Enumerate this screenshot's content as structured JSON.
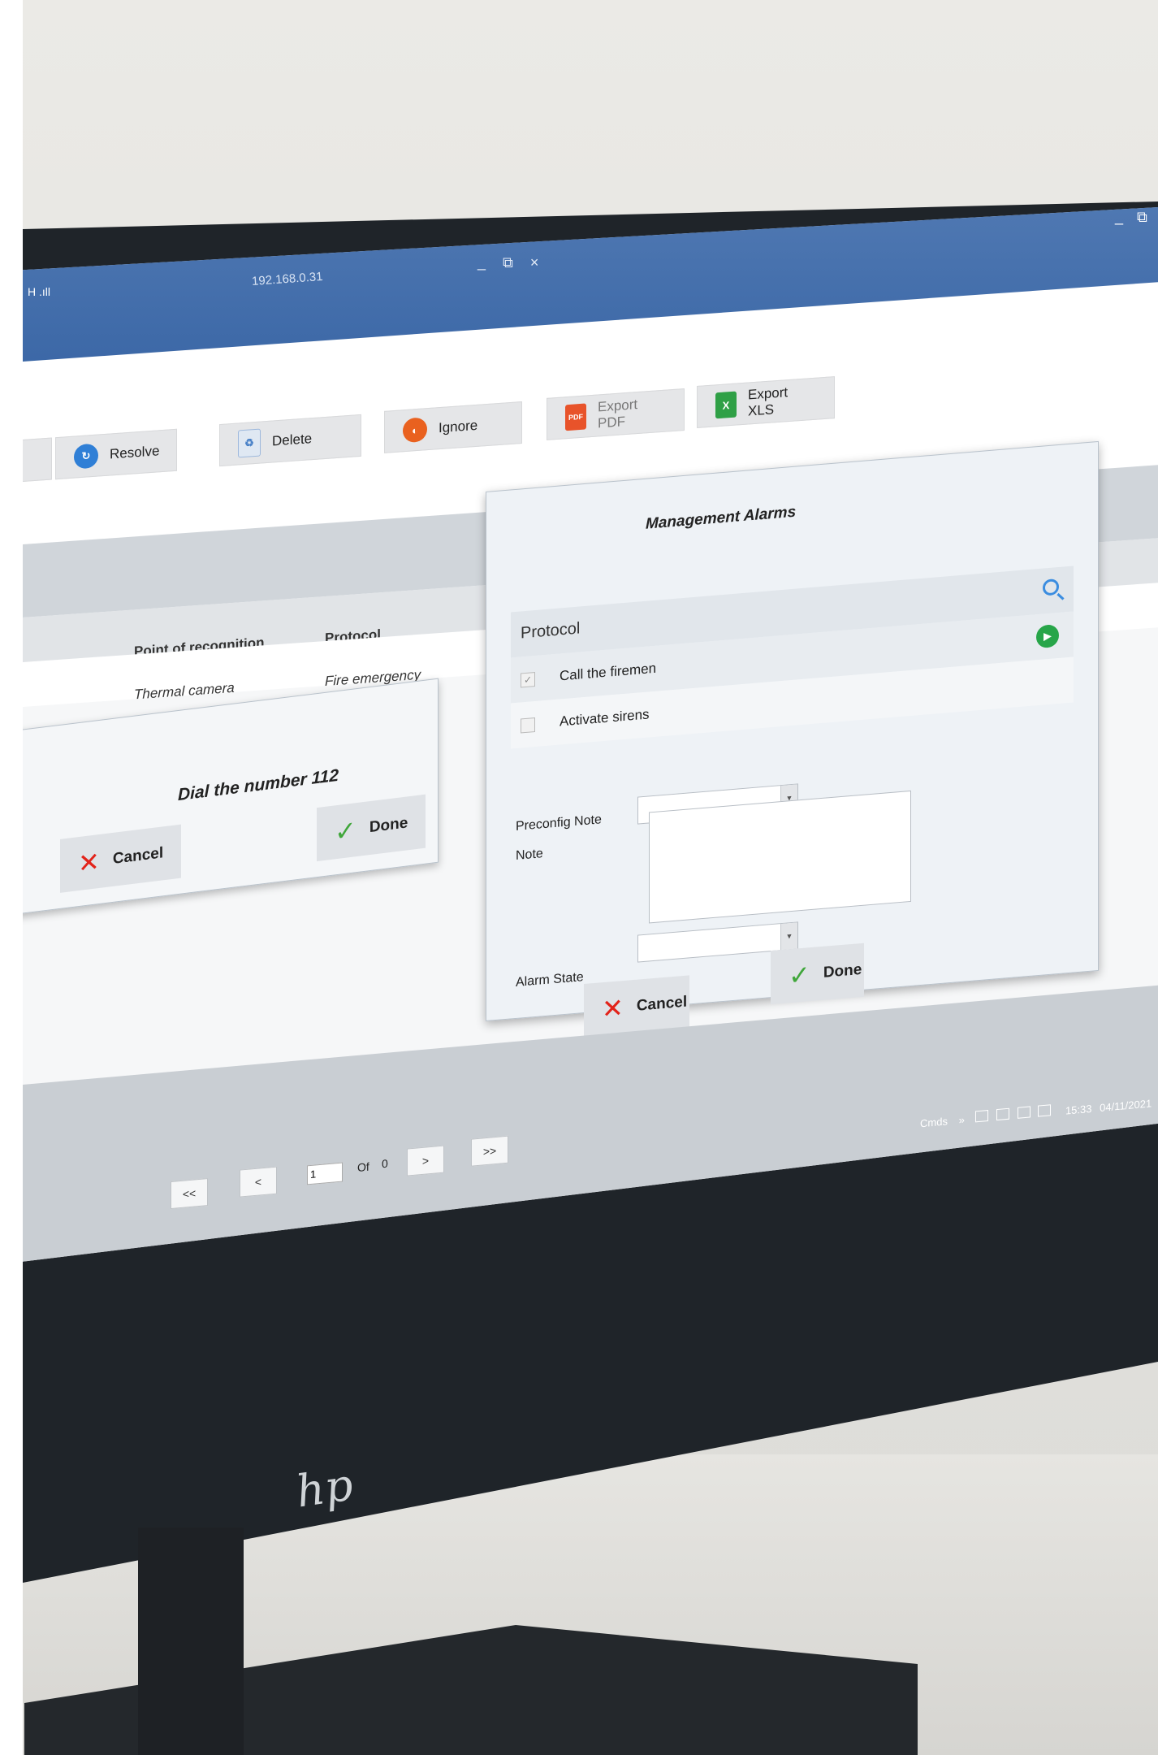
{
  "titlebar": {
    "ip_address": "192.168.0.31",
    "signal_label": "H .ıll",
    "inner_window_controls": "_ ⧉ ×",
    "outer_window_controls": "_ ⧉"
  },
  "toolbar": {
    "buttons": [
      {
        "label": "Resolve",
        "icon": "resolve-icon",
        "color": "#2f7fd6"
      },
      {
        "label": "Delete",
        "icon": "recycle-icon",
        "color": "#5a8fd0"
      },
      {
        "label": "Ignore",
        "icon": "ignore-icon",
        "color": "#e9611f"
      },
      {
        "label": "Export PDF",
        "icon": "pdf-icon",
        "color": "#e8532a"
      },
      {
        "label": "Export XLS",
        "icon": "xls-icon",
        "color": "#2fa046"
      }
    ]
  },
  "grid": {
    "columns": [
      "Point of recognition",
      "Protocol"
    ],
    "rows": [
      {
        "point_of_recognition": "Thermal camera",
        "protocol": "Fire emergency"
      }
    ]
  },
  "step_dialog": {
    "message": "Dial the number 112",
    "cancel_label": "Cancel",
    "done_label": "Done"
  },
  "management_dialog": {
    "title": "Management Alarms",
    "protocol_label": "Protocol",
    "protocol_items": [
      {
        "label": "Call the firemen",
        "checked": true
      },
      {
        "label": "Activate sirens",
        "checked": false
      }
    ],
    "preconfig_note_label": "Preconfig Note",
    "preconfig_note_value": "",
    "note_label": "Note",
    "note_value": "",
    "alarm_state_label": "Alarm State",
    "alarm_state_value": "",
    "cancel_label": "Cancel",
    "done_label": "Done"
  },
  "pagination": {
    "first": "<<",
    "prev": "<",
    "page": "1",
    "of_label": "Of",
    "total": "0",
    "next": ">",
    "last": ">>"
  },
  "taskbar": {
    "cmds_label": "Cmds",
    "chevron": "»",
    "time": "15:33",
    "date": "04/11/2021"
  },
  "brand": {
    "logo_text": "hp"
  },
  "colors": {
    "titlebar": "#3b67a6",
    "cancel_x": "#e2231a",
    "done_check": "#3fa63a",
    "play": "#27a549"
  }
}
